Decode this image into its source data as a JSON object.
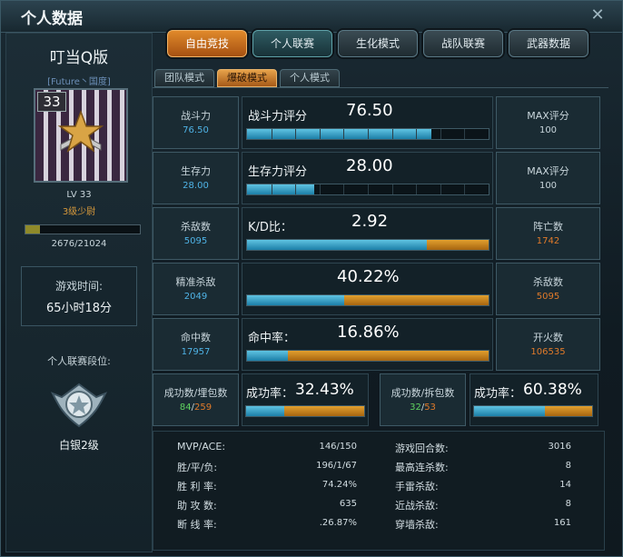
{
  "window": {
    "title": "个人数据",
    "close_icon": "close-icon"
  },
  "profile": {
    "name": "叮当Q版",
    "clan": "[Future丶国度]",
    "level_badge": "33",
    "level": "LV 33",
    "rank": "3级少尉",
    "exp_text": "2676/21024",
    "exp_fraction": 0.127,
    "time_label": "游戏时间:",
    "time_value": "65小时18分",
    "league_label": "个人联赛段位:",
    "league_rank": "白银2级"
  },
  "tabs": [
    {
      "label": "自由竞技",
      "active": true
    },
    {
      "label": "个人联赛"
    },
    {
      "label": "生化模式"
    },
    {
      "label": "战队联赛"
    },
    {
      "label": "武器数据"
    }
  ],
  "subtabs": [
    {
      "label": "团队模式"
    },
    {
      "label": "爆破模式",
      "active": true
    },
    {
      "label": "个人模式"
    }
  ],
  "stats": [
    {
      "left_name": "战斗力",
      "left_value": "76.50",
      "left_color": "#4fb3e6",
      "mid_label": "战斗力评分",
      "mid_value": "76.50",
      "blue": 0.765,
      "orange": 0,
      "right_name": "MAX评分",
      "right_value": "100",
      "right_color": "#c9d6dc",
      "segmented": true
    },
    {
      "left_name": "生存力",
      "left_value": "28.00",
      "left_color": "#4fb3e6",
      "mid_label": "生存力评分",
      "mid_value": "28.00",
      "blue": 0.28,
      "orange": 0,
      "right_name": "MAX评分",
      "right_value": "100",
      "right_color": "#c9d6dc",
      "segmented": true
    },
    {
      "left_name": "杀敌数",
      "left_value": "5095",
      "left_color": "#4fb3e6",
      "mid_label": "K/D比：",
      "mid_value": "2.92",
      "blue": 0.745,
      "orange": 0.255,
      "right_name": "阵亡数",
      "right_value": "1742",
      "right_color": "#e07a2a",
      "segmented": false
    },
    {
      "left_name": "精准杀敌",
      "left_value": "2049",
      "left_color": "#4fb3e6",
      "mid_label": "",
      "mid_value": "40.22%",
      "blue": 0.4022,
      "orange": 0.5978,
      "right_name": "杀敌数",
      "right_value": "5095",
      "right_color": "#e07a2a",
      "segmented": false
    },
    {
      "left_name": "命中数",
      "left_value": "17957",
      "left_color": "#4fb3e6",
      "mid_label": "命中率：",
      "mid_value": "16.86%",
      "blue": 0.1686,
      "orange": 0.8314,
      "right_name": "开火数",
      "right_value": "106535",
      "right_color": "#e07a2a",
      "segmented": false
    }
  ],
  "bomb": {
    "plant_name": "成功数/埋包数",
    "plant_success": "84",
    "plant_total": "259",
    "plant_label": "成功率：",
    "plant_rate": "32.43%",
    "plant_fraction": 0.3243,
    "defuse_name": "成功数/拆包数",
    "defuse_success": "32",
    "defuse_total": "53",
    "defuse_label": "成功率：",
    "defuse_rate": "60.38%",
    "defuse_fraction": 0.6038
  },
  "summary_left": [
    {
      "label": "MVP/ACE:",
      "value": "146/150"
    },
    {
      "label": "胜/平/负:",
      "value": "196/1/67"
    },
    {
      "label": "胜 利 率:",
      "value": "74.24%"
    },
    {
      "label": "助 攻 数:",
      "value": "635"
    },
    {
      "label": "断 线 率:",
      "value": ".26.87%"
    }
  ],
  "summary_right": [
    {
      "label": "游戏回合数:",
      "value": "3016"
    },
    {
      "label": "最高连杀数:",
      "value": "8"
    },
    {
      "label": "手雷杀敌:",
      "value": "14"
    },
    {
      "label": "近战杀敌:",
      "value": "8"
    },
    {
      "label": "穿墙杀敌:",
      "value": "161"
    }
  ]
}
